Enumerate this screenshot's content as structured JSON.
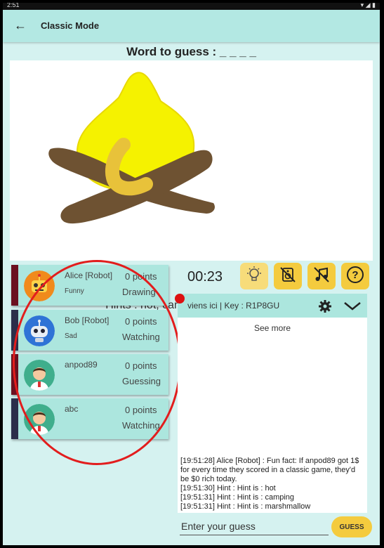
{
  "status_bar": {
    "time": "2:51",
    "right": "▾ ◢ ▮"
  },
  "app_bar": {
    "back_icon": "arrow-left-icon",
    "title": "Classic Mode"
  },
  "word": {
    "label": "Word to guess : _ _ _ _"
  },
  "hints": {
    "text": "Hints : hot, camping, marshmallow"
  },
  "players": [
    {
      "name": "Alice [Robot]",
      "mood": "Funny",
      "points": "0 points",
      "state": "Drawing",
      "bar_color": "#6b1020",
      "avatar": "orange-robot-avatar"
    },
    {
      "name": "Bob [Robot]",
      "mood": "Sad",
      "points": "0 points",
      "state": "Watching",
      "bar_color": "#2b2e4a",
      "avatar": "blue-robot-avatar"
    },
    {
      "name": "anpod89",
      "mood": "",
      "points": "0 points",
      "state": "Guessing",
      "bar_color": "#6b1020",
      "avatar": "man-avatar"
    },
    {
      "name": "abc",
      "mood": "",
      "points": "0 points",
      "state": "Watching",
      "bar_color": "#2b2e4a",
      "avatar": "man-avatar"
    }
  ],
  "timer": "00:23",
  "tools": [
    {
      "name": "hint-lightbulb-button",
      "icon": "lightbulb-icon"
    },
    {
      "name": "sound-off-button",
      "icon": "volume-off-icon"
    },
    {
      "name": "music-off-button",
      "icon": "music-off-icon"
    },
    {
      "name": "help-button",
      "icon": "question-icon"
    }
  ],
  "chat": {
    "room_info": "viens ici  | Key : R1P8GU",
    "see_more": "See more",
    "messages": [
      "[19:51:28] Alice [Robot] : Fun fact: If anpod89 got 1$ for every time they scored in a classic game, they'd be $0 rich today.",
      "[19:51:30] Hint : Hint is : hot",
      "[19:51:31] Hint : Hint is : camping",
      "[19:51:31] Hint : Hint is : marshmallow"
    ]
  },
  "guess": {
    "placeholder": "Enter your guess",
    "button_label": "GUESS"
  },
  "colors": {
    "appbar": "#b3e8e3",
    "background": "#d5f2f0",
    "card": "#ace6de",
    "accent_yellow": "#f4cb3e",
    "annotation_red": "#e21d1d"
  }
}
